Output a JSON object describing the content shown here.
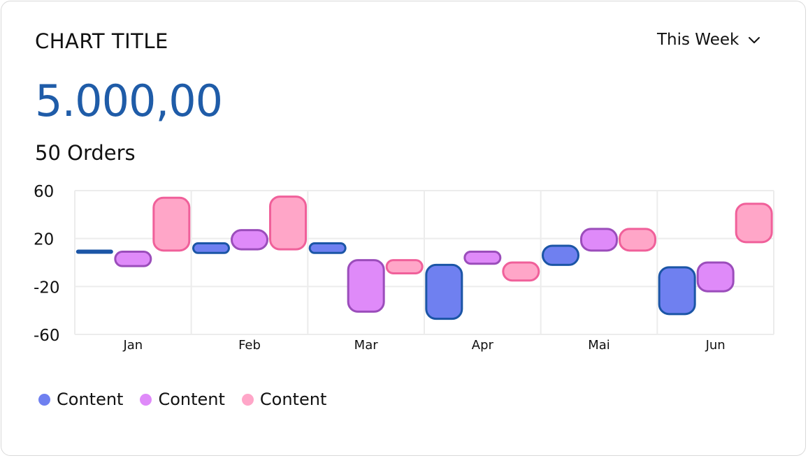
{
  "header": {
    "title": "CHART TITLE",
    "period_label": "This Week",
    "value": "5.000,00",
    "orders": "50 Orders"
  },
  "legend": [
    {
      "label": "Content",
      "color": "#6f80f0"
    },
    {
      "label": "Content",
      "color": "#df8af9"
    },
    {
      "label": "Content",
      "color": "#ffa6c8"
    }
  ],
  "chart_data": {
    "type": "bar",
    "categories": [
      "Jan",
      "Feb",
      "Mar",
      "Apr",
      "Mai",
      "Jun"
    ],
    "y_ticks": [
      "60",
      "20",
      "-20",
      "-60"
    ],
    "ylim": [
      -60,
      60
    ],
    "grid": true,
    "legend_position": "bottom-left",
    "series": [
      {
        "fill": "#6f80f0",
        "stroke": "#1b55a6",
        "ranges": [
          [
            9,
            9
          ],
          [
            8,
            16
          ],
          [
            8,
            16
          ],
          [
            -47,
            -2
          ],
          [
            -2,
            14
          ],
          [
            -43,
            -4
          ]
        ]
      },
      {
        "fill": "#df8af9",
        "stroke": "#9b4dbb",
        "ranges": [
          [
            -3,
            9
          ],
          [
            11,
            27
          ],
          [
            -41,
            2
          ],
          [
            -1,
            9
          ],
          [
            10,
            28
          ],
          [
            -24,
            0
          ]
        ]
      },
      {
        "fill": "#ffa6c8",
        "stroke": "#f0609a",
        "ranges": [
          [
            10,
            54
          ],
          [
            11,
            55
          ],
          [
            -9,
            2
          ],
          [
            -15,
            0
          ],
          [
            10,
            28
          ],
          [
            17,
            49
          ]
        ]
      }
    ]
  }
}
